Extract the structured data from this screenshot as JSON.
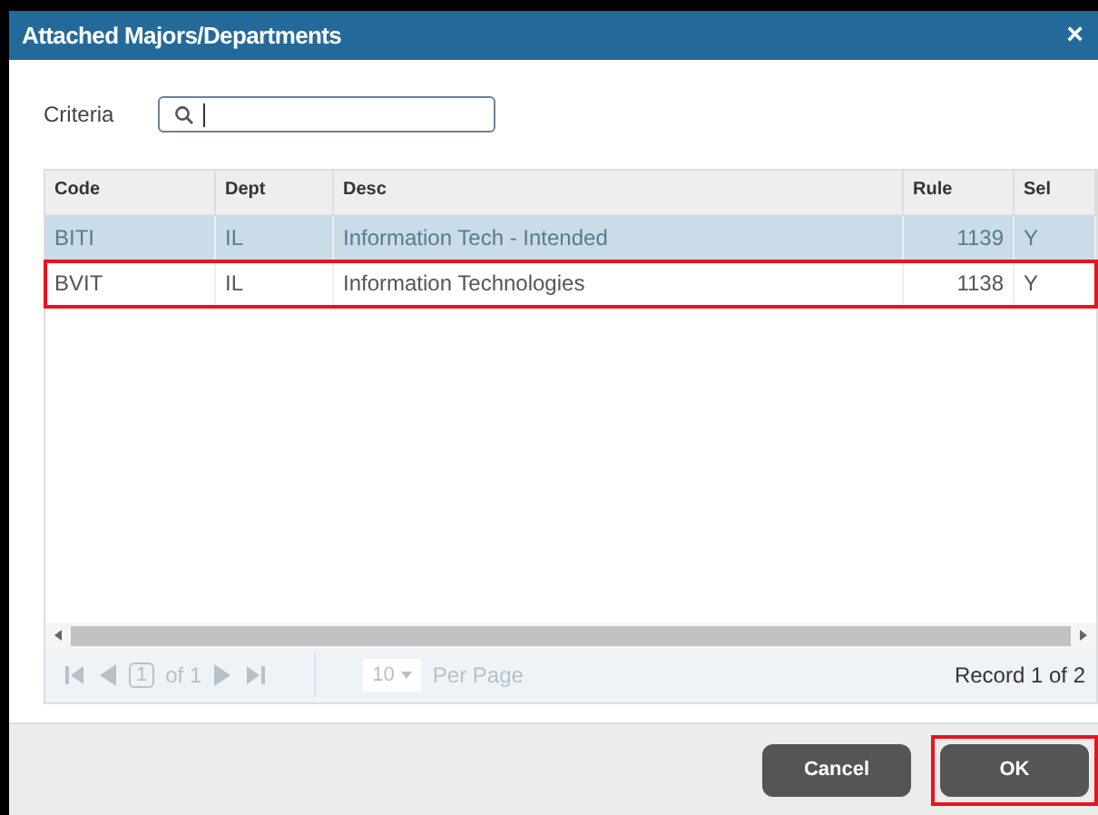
{
  "window": {
    "title": "Attached Majors/Departments",
    "close": "×"
  },
  "criteria": {
    "label": "Criteria"
  },
  "table": {
    "columns": [
      {
        "label": "Code"
      },
      {
        "label": "Dept"
      },
      {
        "label": "Desc"
      },
      {
        "label": "Rule"
      },
      {
        "label": "Sel"
      }
    ],
    "rows": [
      {
        "cells": [
          "BITI",
          "IL",
          "Information Tech - Intended",
          "1139",
          "Y"
        ],
        "selected": true,
        "highlighted": false
      },
      {
        "cells": [
          "BVIT",
          "IL",
          "Information Technologies",
          "1138",
          "Y"
        ],
        "selected": false,
        "highlighted": true
      }
    ]
  },
  "pager": {
    "page": "1",
    "of": "of 1",
    "per_page": "10",
    "per_page_label": "Per Page",
    "record": "Record 1 of 2",
    "disabled": true
  },
  "buttons": [
    {
      "label": "Cancel",
      "highlighted": false
    },
    {
      "label": "OK",
      "highlighted": true
    }
  ]
}
